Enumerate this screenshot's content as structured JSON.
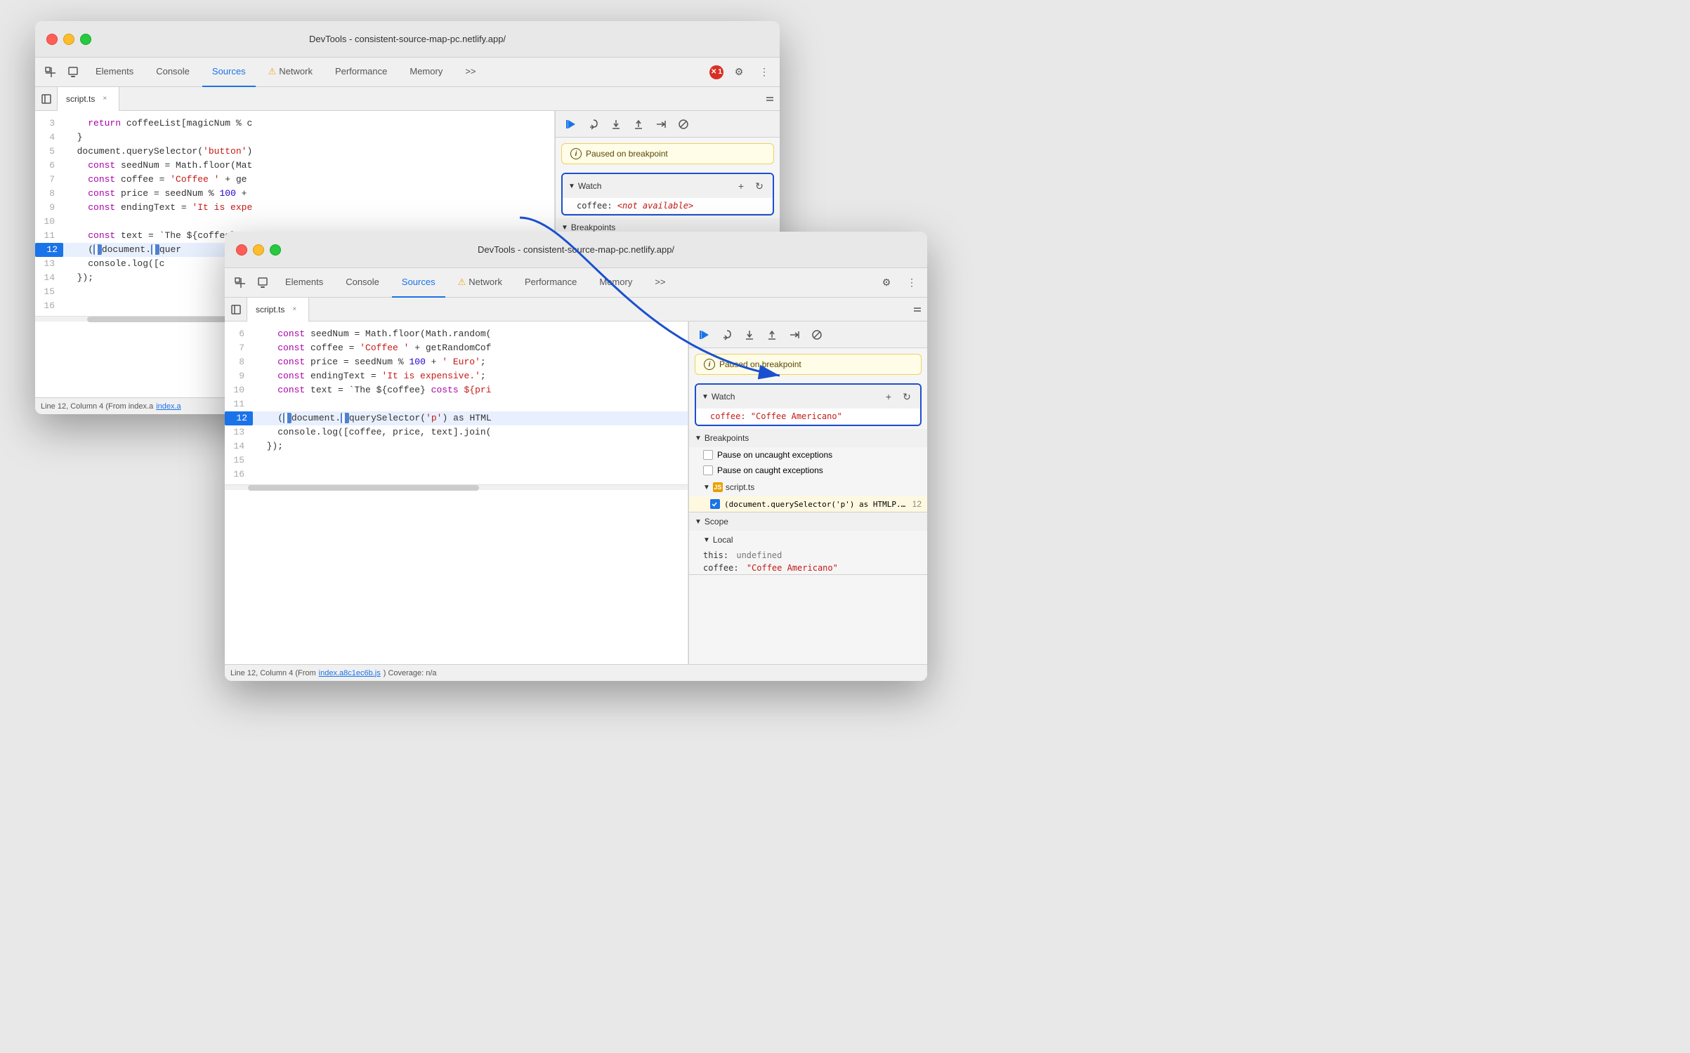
{
  "window1": {
    "title": "DevTools - consistent-source-map-pc.netlify.app/",
    "tabs": [
      "Elements",
      "Console",
      "Sources",
      "Network",
      "Performance",
      "Memory"
    ],
    "active_tab": "Sources",
    "file_tab": "script.ts",
    "code_lines": [
      {
        "num": 3,
        "content": "    return coffeeList[magicNum % c",
        "highlight": false
      },
      {
        "num": 4,
        "content": "  }",
        "highlight": false
      },
      {
        "num": 5,
        "content": "  document.querySelector('button')",
        "highlight": false
      },
      {
        "num": 6,
        "content": "    const seedNum = Math.floor(Mat",
        "highlight": false
      },
      {
        "num": 7,
        "content": "    const coffee = 'Coffee ' + ge",
        "highlight": false
      },
      {
        "num": 8,
        "content": "    const price = seedNum % 100 +",
        "highlight": false
      },
      {
        "num": 9,
        "content": "    const endingText = 'It is expe",
        "highlight": false
      },
      {
        "num": 10,
        "content": "",
        "highlight": false
      },
      {
        "num": 11,
        "content": "    const text = `The ${coffee} cc",
        "highlight": false
      },
      {
        "num": 12,
        "content": "    (document.querySelector",
        "highlight": true
      },
      {
        "num": 13,
        "content": "    console.log([c",
        "highlight": false
      },
      {
        "num": 14,
        "content": "  });",
        "highlight": false
      },
      {
        "num": 15,
        "content": "",
        "highlight": false
      },
      {
        "num": 16,
        "content": "",
        "highlight": false
      }
    ],
    "watch_label": "Watch",
    "watch_items": [
      {
        "key": "coffee",
        "value": "<not available>",
        "unavailable": true
      }
    ],
    "breakpoints_label": "Breakpoints",
    "paused_text": "Paused on breakpoint",
    "status_bar": "Line 12, Column 4  (From index.a",
    "status_link": "index.a"
  },
  "window2": {
    "title": "DevTools - consistent-source-map-pc.netlify.app/",
    "tabs": [
      "Elements",
      "Console",
      "Sources",
      "Network",
      "Performance",
      "Memory"
    ],
    "active_tab": "Sources",
    "file_tab": "script.ts",
    "code_lines": [
      {
        "num": 6,
        "content": "    const seedNum = Math.floor(Math.random(",
        "highlight": false
      },
      {
        "num": 7,
        "content": "    const coffee = 'Coffee ' + getRandomCof",
        "highlight": false
      },
      {
        "num": 8,
        "content": "    const price = seedNum % 100 + ' Euro';",
        "highlight": false
      },
      {
        "num": 9,
        "content": "    const endingText = 'It is expensive.';",
        "highlight": false
      },
      {
        "num": 10,
        "content": "    const text = `The ${coffee} costs ${pri",
        "highlight": false
      },
      {
        "num": 11,
        "content": "",
        "highlight": false
      },
      {
        "num": 12,
        "content": "    (document.querySelector('p') as HTML",
        "highlight": true
      },
      {
        "num": 13,
        "content": "    console.log([coffee, price, text].join(",
        "highlight": false
      },
      {
        "num": 14,
        "content": "  });",
        "highlight": false
      },
      {
        "num": 15,
        "content": "",
        "highlight": false
      },
      {
        "num": 16,
        "content": "",
        "highlight": false
      }
    ],
    "watch_label": "Watch",
    "watch_items": [
      {
        "key": "coffee",
        "value": "\"Coffee Americano\"",
        "unavailable": false
      }
    ],
    "breakpoints_label": "Breakpoints",
    "paused_text": "Paused on breakpoint",
    "pause_uncaught_label": "Pause on uncaught exceptions",
    "pause_caught_label": "Pause on caught exceptions",
    "script_ts_label": "script.ts",
    "bp_line_label": "(document.querySelector('p') as HTMLP...",
    "bp_line_number": "12",
    "scope_label": "Scope",
    "local_label": "Local",
    "this_label": "this:",
    "this_val": "undefined",
    "coffee_label": "coffee:",
    "coffee_val": "\"Coffee Americano\"",
    "status_bar": "Line 12, Column 4  (From ",
    "status_link": "index.a8c1ec6b.js",
    "status_coverage": ") Coverage: n/a"
  },
  "annotation": {
    "arrow_text": ""
  },
  "icons": {
    "play": "▶",
    "step_over": "↷",
    "step_into": "↓",
    "step_out": "↑",
    "continue": "→",
    "deactivate": "⊘",
    "add": "+",
    "refresh": "↻",
    "close": "×",
    "info": "i",
    "settings": "⚙",
    "more": "⋮",
    "warning": "⚠"
  }
}
